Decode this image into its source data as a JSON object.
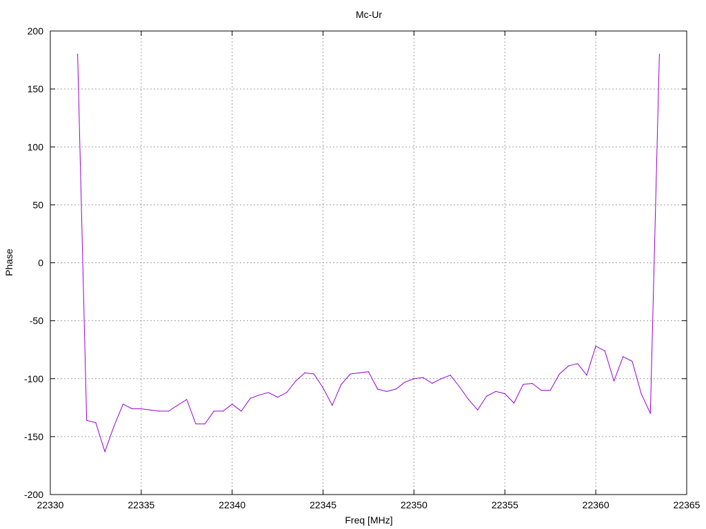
{
  "chart_data": {
    "type": "line",
    "title": "Mc-Ur",
    "xlabel": "Freq [MHz]",
    "ylabel": "Phase",
    "xlim": [
      22330,
      22365
    ],
    "ylim": [
      -200,
      200
    ],
    "xticks": [
      22330,
      22335,
      22340,
      22345,
      22350,
      22355,
      22360,
      22365
    ],
    "yticks": [
      -200,
      -150,
      -100,
      -50,
      0,
      50,
      100,
      150,
      200
    ],
    "grid": true,
    "legend": "none",
    "series": [
      {
        "color": "#9400d3",
        "x": [
          22331.5,
          22332.0,
          22332.5,
          22333.0,
          22333.5,
          22334.0,
          22334.5,
          22335.0,
          22335.5,
          22336.0,
          22336.5,
          22337.0,
          22337.5,
          22338.0,
          22338.5,
          22339.0,
          22339.5,
          22340.0,
          22340.5,
          22341.0,
          22341.5,
          22342.0,
          22342.5,
          22343.0,
          22343.5,
          22344.0,
          22344.5,
          22345.0,
          22345.5,
          22346.0,
          22346.5,
          22347.0,
          22347.5,
          22348.0,
          22348.5,
          22349.0,
          22349.5,
          22350.0,
          22350.5,
          22351.0,
          22351.5,
          22352.0,
          22352.5,
          22353.0,
          22353.5,
          22354.0,
          22354.5,
          22355.0,
          22355.5,
          22356.0,
          22356.5,
          22357.0,
          22357.5,
          22358.0,
          22358.5,
          22359.0,
          22359.5,
          22360.0,
          22360.5,
          22361.0,
          22361.5,
          22362.0,
          22362.5,
          22363.0,
          22363.5
        ],
        "y": [
          180,
          -136,
          -138,
          -163,
          -141,
          -122,
          -126,
          -126,
          -127,
          -128,
          -128,
          -123,
          -118,
          -139,
          -139,
          -128,
          -128,
          -122,
          -128,
          -117,
          -114,
          -112,
          -116,
          -112,
          -102,
          -95,
          -96,
          -108,
          -123,
          -105,
          -96,
          -95,
          -94,
          -109,
          -111,
          -109,
          -103,
          -100,
          -99,
          -104,
          -100,
          -97,
          -107,
          -118,
          -127,
          -115,
          -111,
          -113,
          -121,
          -105,
          -104,
          -110,
          -110,
          -96,
          -89,
          -87,
          -97,
          -72,
          -76,
          -102,
          -81,
          -85,
          -113,
          -130,
          180
        ]
      }
    ]
  }
}
